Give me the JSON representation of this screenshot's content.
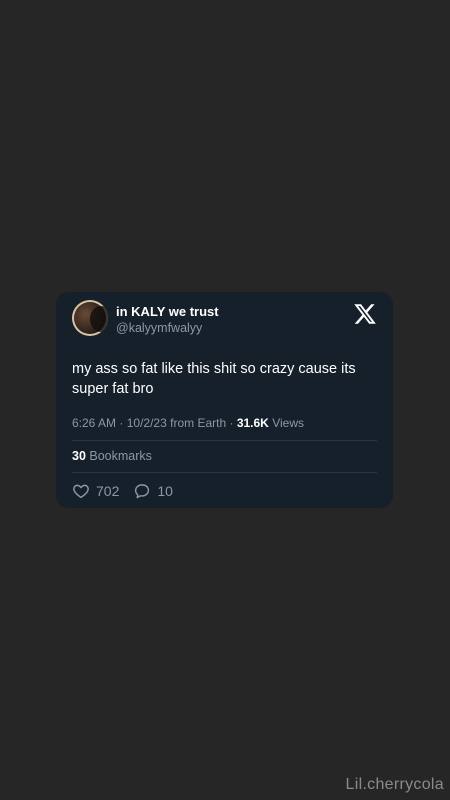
{
  "tweet": {
    "display_name": "in KALY we trust",
    "handle": "@kalyymfwalyy",
    "text": "my ass so fat like this shit so crazy cause its super fat bro",
    "time": "6:26 AM",
    "date": "10/2/23",
    "location": "from Earth",
    "views_count": "31.6K",
    "views_label": "Views",
    "bookmarks_count": "30",
    "bookmarks_label": "Bookmarks",
    "likes": "702",
    "replies": "10"
  },
  "icons": {
    "logo": "x-logo-icon",
    "like": "heart-icon",
    "reply": "reply-icon"
  },
  "watermark": "Lil.cherrycola",
  "colors": {
    "background": "#262626",
    "card": "#15202b",
    "text": "#ffffff",
    "muted": "#8b98a5"
  }
}
